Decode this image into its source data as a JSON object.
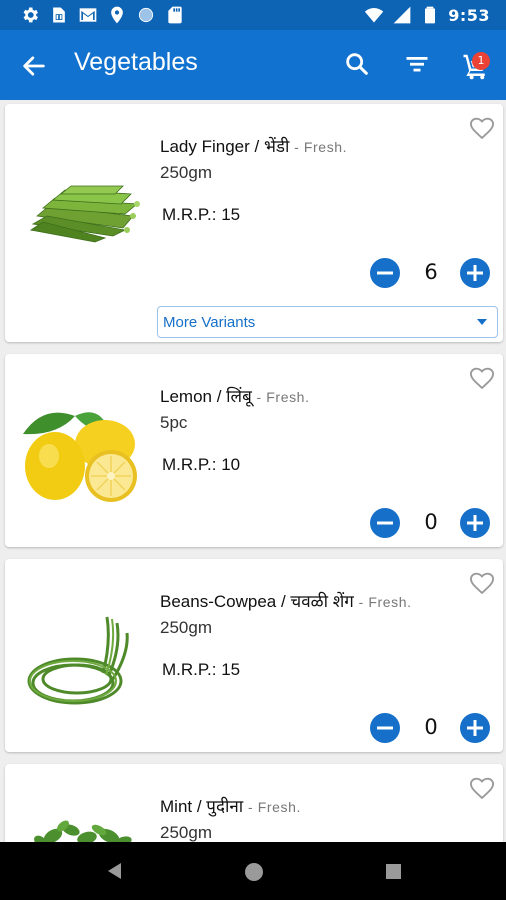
{
  "status_bar": {
    "time": "9:53",
    "left_icons": [
      "settings-icon",
      "sim-icon",
      "gmail-icon",
      "location-icon",
      "circle-icon",
      "sd-card-icon"
    ],
    "right_icons": [
      "wifi-icon",
      "signal-icon",
      "battery-icon"
    ]
  },
  "app_bar": {
    "title": "Vegetables",
    "cart_count": "1",
    "color": "#1272cf"
  },
  "products": [
    {
      "name": "Lady Finger / भेंडी",
      "tag": "- Fresh.",
      "unit": "250gm",
      "mrp": "M.R.P.: 15",
      "quantity": "6",
      "variants_label": "More Variants",
      "image": "okra"
    },
    {
      "name": "Lemon / लिंबू",
      "tag": "- Fresh.",
      "unit": "5pc",
      "mrp": "M.R.P.: 10",
      "quantity": "0",
      "image": "lemon"
    },
    {
      "name": "Beans-Cowpea / चवळी शेंग",
      "tag": "- Fresh.",
      "unit": "250gm",
      "mrp": "M.R.P.: 15",
      "quantity": "0",
      "image": "cowpea-beans"
    },
    {
      "name": "Mint / पुदीना",
      "tag": "- Fresh.",
      "unit": "250gm",
      "image": "mint"
    }
  ],
  "colors": {
    "primary": "#1272cf",
    "status_bar": "#0d64b5",
    "qty_button": "#1670c9",
    "badge": "#ea4335"
  }
}
